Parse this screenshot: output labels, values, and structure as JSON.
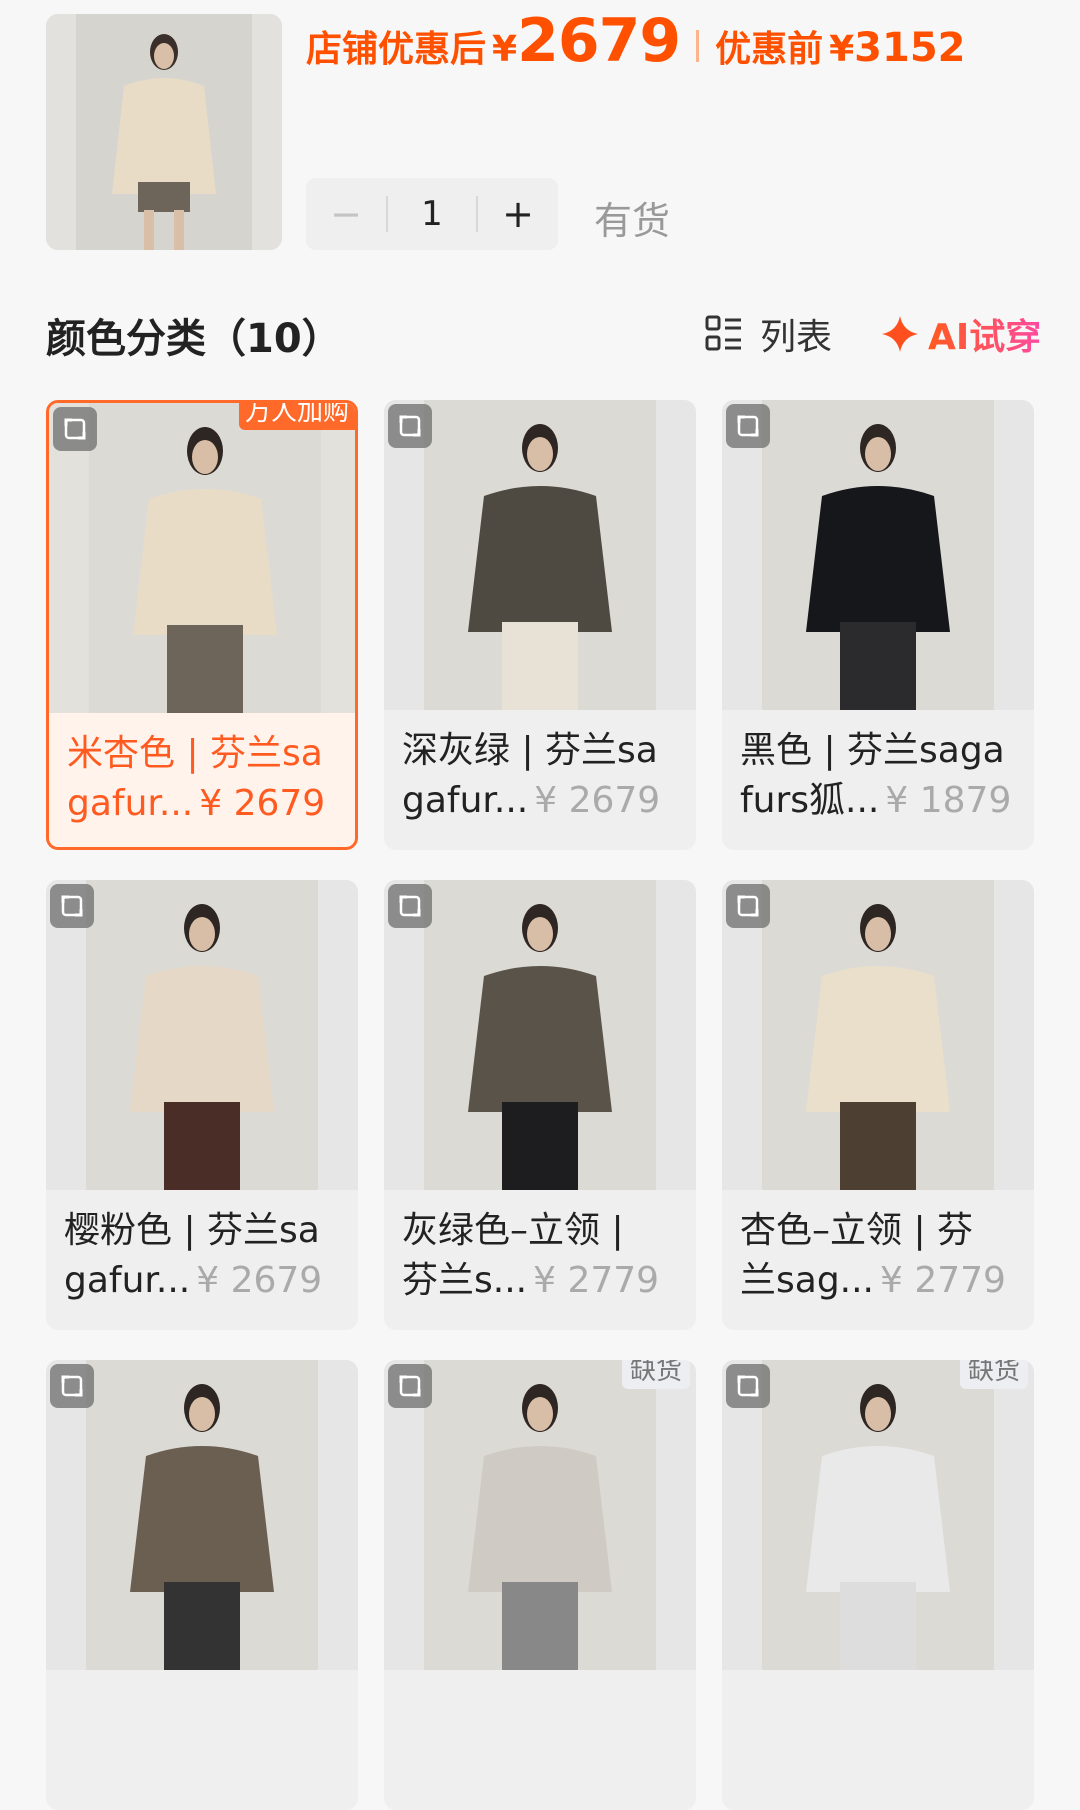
{
  "price": {
    "label": "店铺优惠后",
    "yen": "¥",
    "value": "2679",
    "orig_label": "优惠前",
    "orig_yen": "¥",
    "orig_value": "3152"
  },
  "quantity": {
    "minus": "−",
    "value": "1",
    "plus": "+"
  },
  "stock_status": "有货",
  "section": {
    "title": "颜色分类（10）",
    "list_label": "列表",
    "ai_label": "AI试穿"
  },
  "colors": {
    "accent": "#ff5000",
    "selected_border": "#ff6a2a",
    "muted_price": "#aaaaaa"
  },
  "items": [
    {
      "line1": "米杏色 | 芬兰sa",
      "line2": "gafur...",
      "price": "¥ 2679",
      "badge": "万人加购",
      "selected": true,
      "coat": "#e8dcc6",
      "bottom": "#6d655a"
    },
    {
      "line1": "深灰绿 | 芬兰sa",
      "line2": "gafur...",
      "price": "¥ 2679",
      "badge": "",
      "selected": false,
      "coat": "#4f4a41",
      "bottom": "#e8e2d6"
    },
    {
      "line1": "黑色 | 芬兰saga",
      "line2": "furs狐...",
      "price": "¥ 1879",
      "badge": "",
      "selected": false,
      "coat": "#16171b",
      "bottom": "#2b2b2d"
    },
    {
      "line1": "樱粉色 | 芬兰sa",
      "line2": "gafur...",
      "price": "¥ 2679",
      "badge": "",
      "selected": false,
      "coat": "#e6d8c6",
      "bottom": "#4a2d26"
    },
    {
      "line1": "灰绿色–立领 |",
      "line2": "芬兰s...",
      "price": "¥ 2779",
      "badge": "",
      "selected": false,
      "coat": "#5a534a",
      "bottom": "#1d1d20"
    },
    {
      "line1": "杏色–立领 | 芬",
      "line2": "兰sag...",
      "price": "¥ 2779",
      "badge": "",
      "selected": false,
      "coat": "#e9dfcb",
      "bottom": "#4e3f33"
    },
    {
      "line1": "",
      "line2": "",
      "price": "",
      "badge": "",
      "selected": false,
      "coat": "#6b5f52",
      "bottom": "#333"
    },
    {
      "line1": "",
      "line2": "",
      "price": "",
      "badge": "缺货",
      "selected": false,
      "coat": "#cfcac4",
      "bottom": "#888"
    },
    {
      "line1": "",
      "line2": "",
      "price": "",
      "badge": "缺货",
      "selected": false,
      "coat": "#e9e9ea",
      "bottom": "#ddd"
    }
  ],
  "icons": {
    "expand": "expand-icon",
    "list": "list-view-icon",
    "ai": "sparkle-icon"
  }
}
